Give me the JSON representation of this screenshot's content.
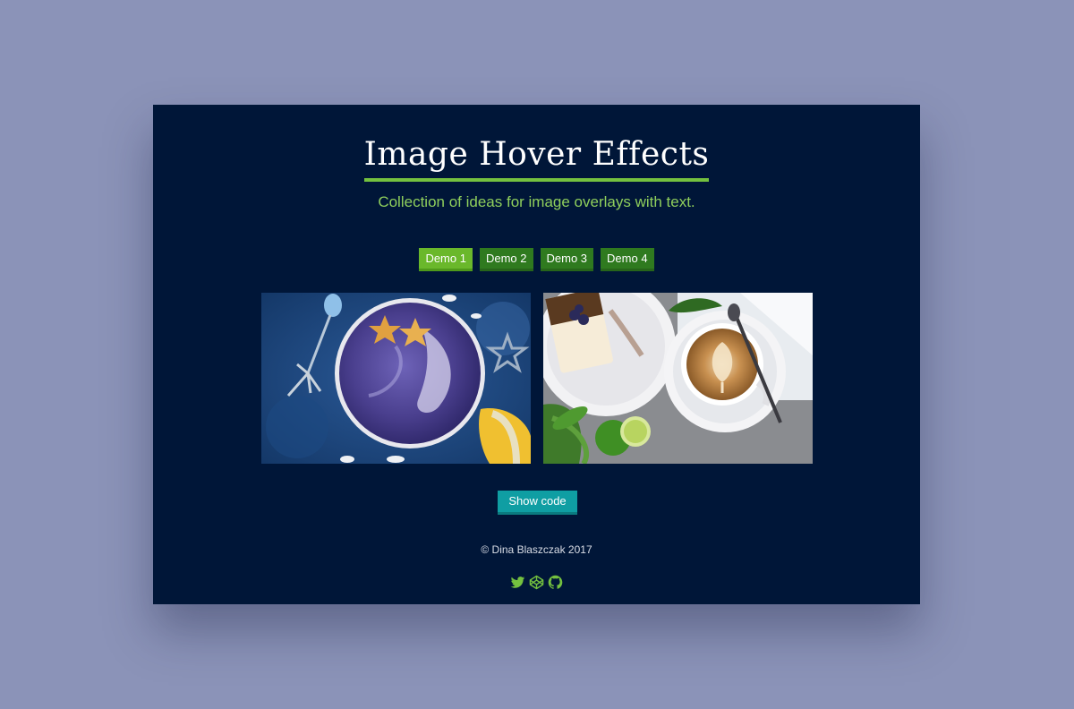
{
  "header": {
    "title": "Image Hover Effects",
    "subtitle": "Collection of ideas for image overlays with text."
  },
  "demos": [
    {
      "label": "Demo 1",
      "active": true
    },
    {
      "label": "Demo 2",
      "active": false
    },
    {
      "label": "Demo 3",
      "active": false
    },
    {
      "label": "Demo 4",
      "active": false
    }
  ],
  "gallery": {
    "items": [
      {
        "icon": "smoothie-bowl-photo"
      },
      {
        "icon": "latte-cake-photo"
      }
    ]
  },
  "actions": {
    "show_code_label": "Show code"
  },
  "footer": {
    "copyright": "© Dina Blaszczak 2017"
  },
  "social": [
    {
      "icon": "twitter-icon"
    },
    {
      "icon": "codepen-icon"
    },
    {
      "icon": "github-icon"
    }
  ],
  "colors": {
    "page_bg": "#8b93b8",
    "card_bg": "#001638",
    "accent_green": "#74c13f",
    "button_green": "#2f7a1f",
    "button_active": "#6ab82b",
    "teal": "#0f9ea3"
  }
}
